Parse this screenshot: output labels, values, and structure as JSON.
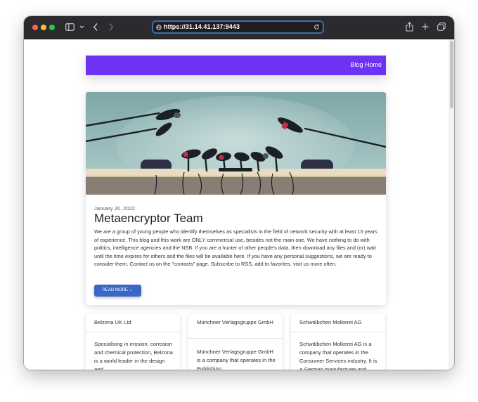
{
  "browser": {
    "url": "https://31.14.41.137:9443",
    "colors": {
      "titlebar": "#2b2a2f",
      "close": "#fe5f57",
      "minimize": "#febc2e",
      "zoom": "#28c840",
      "url_focus": "#3d6ea8"
    }
  },
  "site": {
    "nav_link": "Blog Home",
    "accent": "#6d33f5"
  },
  "post": {
    "date": "January 20, 2022",
    "title": "Metaencryptor Team",
    "body": "We are a group of young people who identify themselves as specialists in the field of network security with at least 15 years of experience. This blog and this work are ONLY commercial use, besides not the main one. We have nothing to do with politics, intelligence agencies and the NSB. If you are a hunter of other people's data, then download any files and (or) wait until the time expires for others and the files will be available here. If you have any personal suggestions, we are ready to consider them. Contact us on the \"contacts\" page. Subscribe to RSS, add to favorites, visit us more often.",
    "button_label": "READ MORE →"
  },
  "cards": [
    {
      "title": "Belzona UK Ltd",
      "body": "Specialising in erosion, corrosion and chemical protection, Belzona is a world leader in the design and"
    },
    {
      "title": "Münchner Verlagsgruppe GmbH",
      "body": "Münchner Verlagsgruppe GmbH is a company that operates in the Publishing"
    },
    {
      "title": "Schwälbchen Molkerei AG",
      "body": "Schwälbchen Molkerei AG is a company that operates in the Consumer Services industry. It is a German manufacturer and"
    }
  ]
}
